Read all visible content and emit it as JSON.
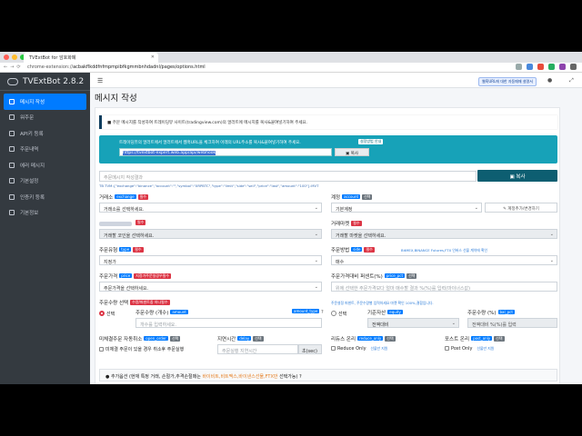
{
  "browser": {
    "tab_title": "TVExtBot for 암호화폐",
    "url_prefix": "chrome-extension://",
    "url_path": "acbakflkddfnfmpmpibfkgmmbnhdadnl/pages/options.html"
  },
  "sidebar": {
    "brand": "TVExtBot 2.8.2",
    "items": [
      {
        "label": "메시지 작성",
        "icon": "edit-icon"
      },
      {
        "label": "워주문",
        "icon": "list-icon"
      },
      {
        "label": "API키 등록",
        "icon": "key-icon"
      },
      {
        "label": "주문내역",
        "icon": "history-icon"
      },
      {
        "label": "에러 메시지",
        "icon": "alert-icon"
      },
      {
        "label": "기본설정",
        "icon": "gear-icon"
      },
      {
        "label": "인증키 등록",
        "icon": "lock-icon"
      },
      {
        "label": "기본정보",
        "icon": "info-icon"
      }
    ]
  },
  "topnav": {
    "notice": "웹훅URL에 대한 자동매매 설명서"
  },
  "page": {
    "title": "메시지 작성",
    "callout": "주문 메시지를 작성하여 트레이딩뷰 사이트(tradingview.com)의 얼러트에 메시지를 복사&붙여넣기하여 주세요.",
    "webhook_msg": "트레이딩뷰의 얼러트에서 얼러트에서 웹훅URL을 체크하여 아래의 URL주소를 복사&붙여넣기하여 주세요.",
    "webhook_badge": "설정방법 안내",
    "webhook_url": "https://tvextbot-expert.web.app/api/webhook",
    "webhook_copy": "복사",
    "message_placeholder": "주문메시지 작성결과",
    "copy_button": "복사",
    "json_preview": "TB TVM:{\"exchange\":\"binance\",\"account\":\"\",\"symbol\":\"XRPBTC\",\"type\":\"limit\",\"side\":\"sell\",\"price\":\"last\",\"amount\":\"100\"}:MVT"
  },
  "form": {
    "exchange": {
      "label": "거래소",
      "tag": "exchange",
      "req": "필수",
      "value": "거래소를 선택하세요."
    },
    "account": {
      "label": "계정",
      "tag": "account",
      "req": "선택",
      "value": "기본계정",
      "button": "계정추가/변경하기"
    },
    "coin": {
      "req": "필수",
      "value": "거래할 코인을 선택하세요."
    },
    "market": {
      "label": "거래마켓",
      "req": "필수",
      "value": "거래할 마켓을 선택하세요."
    },
    "order_type": {
      "label": "주문유형",
      "tag": "type",
      "req": "필수",
      "value": "지정가"
    },
    "side": {
      "label": "주문방법",
      "tag": "side",
      "req": "필수",
      "hint": "BitMEX,BINANCE Futures,FTX 인버스 선물 계약에 확인",
      "value": "매수"
    },
    "price": {
      "label": "주문가격",
      "tag": "price",
      "req": "지정가주문일경우필수",
      "value": "주문가격을 선택하세요."
    },
    "price_pct": {
      "label": "주문가격대비 퍼센트(%)",
      "tag": "price_pct",
      "req": "선택",
      "placeholder": "위에 선택한 주문가격보다 얼마 매수할 결과 %(%)를 입력(마이너스값)"
    },
    "amount": {
      "label": "주문수량 선택",
      "req": "수량/퍼센트중 하나필수",
      "radio": "선택",
      "qty_label": "주문수량 (개수)",
      "qty_tag": "amount",
      "type_tag": "amount_type",
      "qty_placeholder": "개수를 입력하세요.",
      "note": "주문설정 퍼센트, 주문수량별 입력하세요 마켓 확인 100%,결합입니다.",
      "radio2": "선택",
      "base_label": "기준자산",
      "base_tag": "equity",
      "base_value": "전액대비",
      "pct_label": "주문수량 (%)",
      "pct_tag": "bal_pct",
      "pct_placeholder": "전액대비 %(%)를 입력"
    },
    "cancel": {
      "label": "미체결주문 자동취소",
      "tag": "open_order",
      "req": "선택",
      "check": "미체결 주문이 있을 경우 취소후 주문실행"
    },
    "delay": {
      "label": "지연시간",
      "tag": "delay",
      "req": "선택",
      "placeholder": "주문실행 지연시간",
      "unit": "초(sec)"
    },
    "reduce": {
      "label": "리듀스 온리",
      "tag": "reduce_only",
      "req": "선택",
      "check": "Reduce Only",
      "hint": "선물만 지원"
    },
    "post": {
      "label": "포스트 온리",
      "tag": "post_only",
      "req": "선택",
      "check": "Post Only",
      "hint": "선물만 지원"
    },
    "extra": {
      "label": "추가옵션 (현재 특정 거래, 손절가,추격손절매는",
      "highlight": "바이비트,비트맥스,바이낸스선물,FTX만",
      "suffix": "선택가능)"
    }
  }
}
